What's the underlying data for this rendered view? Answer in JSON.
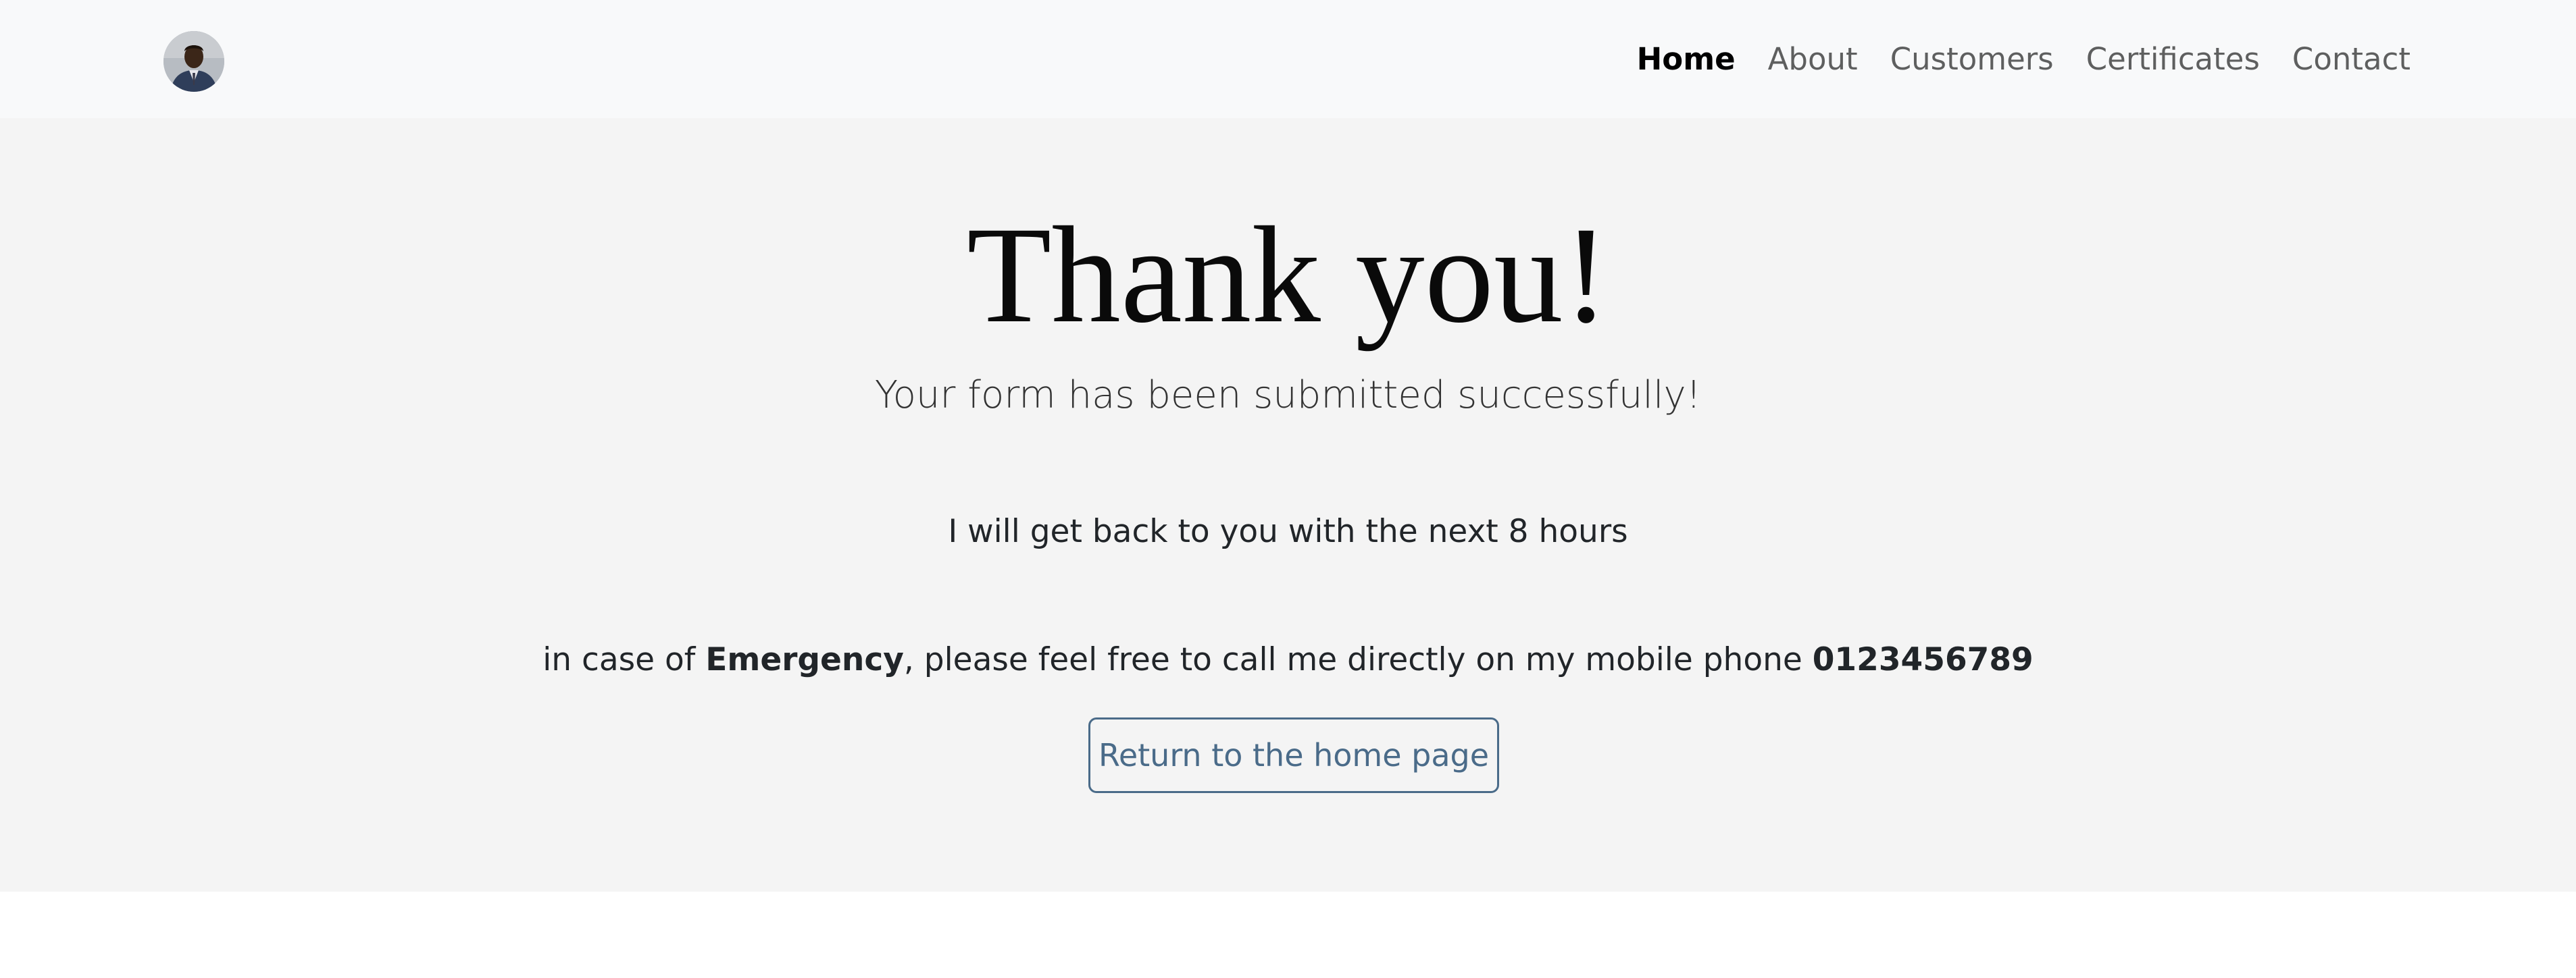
{
  "navbar": {
    "avatar_icon": "profile-photo",
    "links": [
      {
        "label": "Home",
        "active": true
      },
      {
        "label": "About",
        "active": false
      },
      {
        "label": "Customers",
        "active": false
      },
      {
        "label": "Certificates",
        "active": false
      },
      {
        "label": "Contact",
        "active": false
      }
    ]
  },
  "main": {
    "title": "Thank you!",
    "subtitle": "Your form has been submitted successfully!",
    "note": "I will get back to you with the next 8 hours",
    "emergency": {
      "prefix": "in case of ",
      "keyword": "Emergency",
      "middle": ", please feel free to call me directly on my mobile phone ",
      "phone": "0123456789"
    },
    "button_label": "Return to the home page"
  },
  "colors": {
    "navbar_bg": "#f8f9fa",
    "hero_bg": "#f4f4f4",
    "button_accent": "#4a6b89"
  }
}
